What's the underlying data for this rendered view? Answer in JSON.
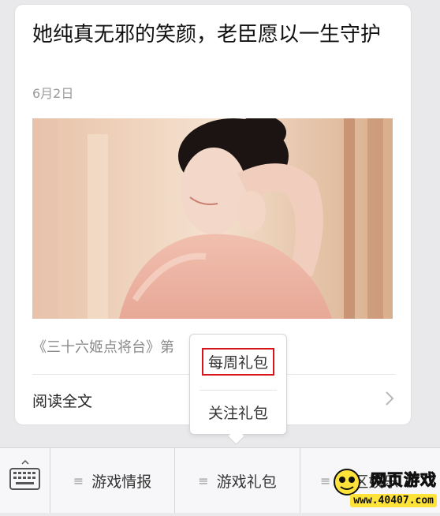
{
  "article": {
    "title": "她纯真无邪的笑颜，老臣愿以一生守护",
    "date": "6月2日",
    "digest": "《三十六姬点将台》第",
    "read_more": "阅读全文"
  },
  "menu": {
    "items": [
      {
        "label": "游戏情报"
      },
      {
        "label": "游戏礼包"
      },
      {
        "label": "社区娱乐"
      }
    ]
  },
  "popup": {
    "items": [
      {
        "label": "每周礼包",
        "highlighted": true
      },
      {
        "label": "关注礼包"
      }
    ]
  },
  "watermark": {
    "name": "网页游戏",
    "url": "www.40407.com"
  },
  "icons": [
    "keyboard-icon",
    "menu-lines-icon",
    "chevron-right-icon"
  ],
  "colors": {
    "highlight_border": "#d9141a",
    "watermark_yellow": "#ffe23a"
  }
}
